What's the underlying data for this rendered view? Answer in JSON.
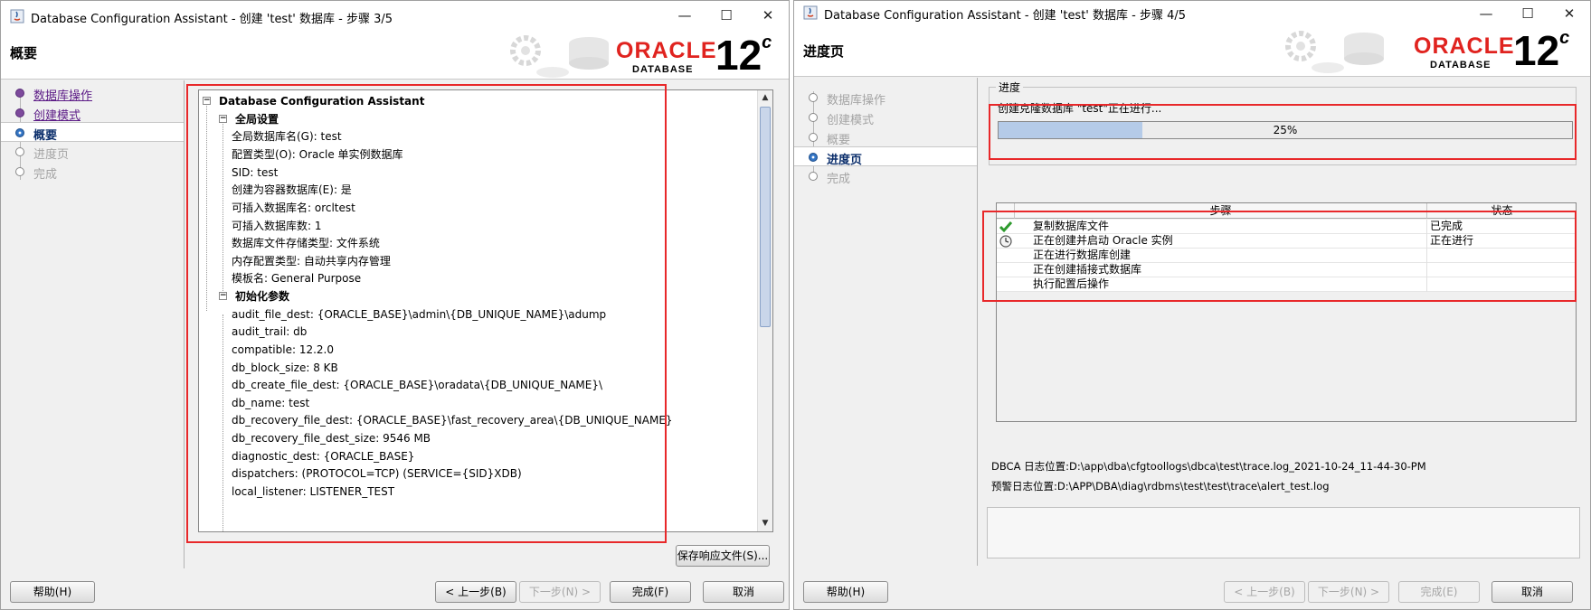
{
  "left_window": {
    "title": "Database Configuration Assistant - 创建 'test' 数据库 - 步骤 3/5",
    "page_title": "概要",
    "logo": {
      "oracle": "ORACLE",
      "database": "DATABASE",
      "version": "12",
      "version_suffix": "c"
    },
    "steps": [
      {
        "label": "数据库操作",
        "state": "done"
      },
      {
        "label": "创建模式",
        "state": "done"
      },
      {
        "label": "概要",
        "state": "current"
      },
      {
        "label": "进度页",
        "state": "pending"
      },
      {
        "label": "完成",
        "state": "pending"
      }
    ],
    "tree": {
      "root": "Database Configuration Assistant",
      "global_section": "全局设置",
      "global_items": [
        "全局数据库名(G): test",
        "配置类型(O): Oracle 单实例数据库",
        "SID: test",
        "创建为容器数据库(E): 是",
        "可插入数据库名: orcltest",
        "可插入数据库数: 1",
        "数据库文件存储类型: 文件系统",
        "内存配置类型: 自动共享内存管理",
        "模板名: General Purpose"
      ],
      "init_section": "初始化参数",
      "init_items": [
        "audit_file_dest: {ORACLE_BASE}\\admin\\{DB_UNIQUE_NAME}\\adump",
        "audit_trail: db",
        "compatible: 12.2.0",
        "db_block_size: 8 KB",
        "db_create_file_dest: {ORACLE_BASE}\\oradata\\{DB_UNIQUE_NAME}\\",
        "db_name: test",
        "db_recovery_file_dest: {ORACLE_BASE}\\fast_recovery_area\\{DB_UNIQUE_NAME}",
        "db_recovery_file_dest_size: 9546 MB",
        "diagnostic_dest: {ORACLE_BASE}",
        "dispatchers: (PROTOCOL=TCP) (SERVICE={SID}XDB)",
        "local_listener: LISTENER_TEST"
      ]
    },
    "buttons": {
      "save_response": "保存响应文件(S)...",
      "help": "帮助(H)",
      "back": "< 上一步(B)",
      "next": "下一步(N) >",
      "finish": "完成(F)",
      "cancel": "取消"
    }
  },
  "right_window": {
    "title": "Database Configuration Assistant - 创建 'test' 数据库 - 步骤 4/5",
    "page_title": "进度页",
    "logo": {
      "oracle": "ORACLE",
      "database": "DATABASE",
      "version": "12",
      "version_suffix": "c"
    },
    "steps": [
      {
        "label": "数据库操作",
        "state": "pending"
      },
      {
        "label": "创建模式",
        "state": "pending"
      },
      {
        "label": "概要",
        "state": "pending"
      },
      {
        "label": "进度页",
        "state": "current"
      },
      {
        "label": "完成",
        "state": "pending"
      }
    ],
    "progress": {
      "group_label": "进度",
      "message": "创建克隆数据库 \"test\"正在进行...",
      "percent_text": "25%",
      "percent": 25
    },
    "step_table": {
      "headers": [
        "步骤",
        "状态"
      ],
      "rows": [
        {
          "name": "复制数据库文件",
          "status": "已完成",
          "icon": "check-icon"
        },
        {
          "name": "正在创建并启动 Oracle 实例",
          "status": "正在进行",
          "icon": "clock-icon"
        },
        {
          "name": "正在进行数据库创建",
          "status": "",
          "icon": ""
        },
        {
          "name": "正在创建插接式数据库",
          "status": "",
          "icon": ""
        },
        {
          "name": "执行配置后操作",
          "status": "",
          "icon": ""
        }
      ]
    },
    "log": {
      "dbca_log": "DBCA 日志位置:D:\\app\\dba\\cfgtoollogs\\dbca\\test\\trace.log_2021-10-24_11-44-30-PM",
      "alert_log": "预警日志位置:D:\\APP\\DBA\\diag\\rdbms\\test\\test\\trace\\alert_test.log"
    },
    "buttons": {
      "help": "帮助(H)",
      "back": "< 上一步(B)",
      "next": "下一步(N) >",
      "finish": "完成(E)",
      "cancel": "取消"
    }
  },
  "colors": {
    "oracle_red": "#e0231f",
    "highlight_red": "#e8282a",
    "link_purple": "#5b1a86",
    "progress_fill": "#b5cbe8"
  }
}
